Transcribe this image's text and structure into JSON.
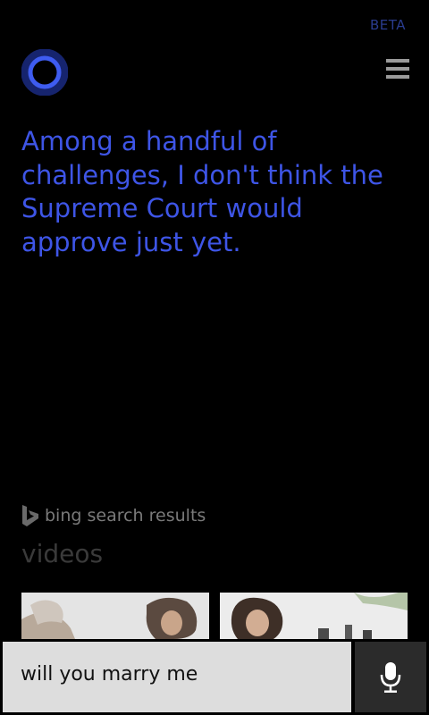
{
  "header": {
    "beta_label": "BETA",
    "cortana_icon": "cortana-ring-icon",
    "menu_icon": "hamburger-menu-icon"
  },
  "response": {
    "text": "Among a handful of challenges, I don't think the Supreme Court would approve just yet."
  },
  "results": {
    "source_label": "bing search results",
    "source_icon": "bing-logo-icon",
    "section_title": "videos",
    "videos": [
      {
        "thumbnail": "video-thumbnail"
      },
      {
        "thumbnail": "video-thumbnail"
      }
    ]
  },
  "query_bar": {
    "query_text": "will you marry me",
    "mic_icon": "microphone-icon"
  },
  "colors": {
    "accent": "#3e55e6",
    "beta": "#2a3c8e",
    "background": "#000000",
    "input_bg": "#dddddd",
    "mic_bg": "#2b2b2b"
  }
}
